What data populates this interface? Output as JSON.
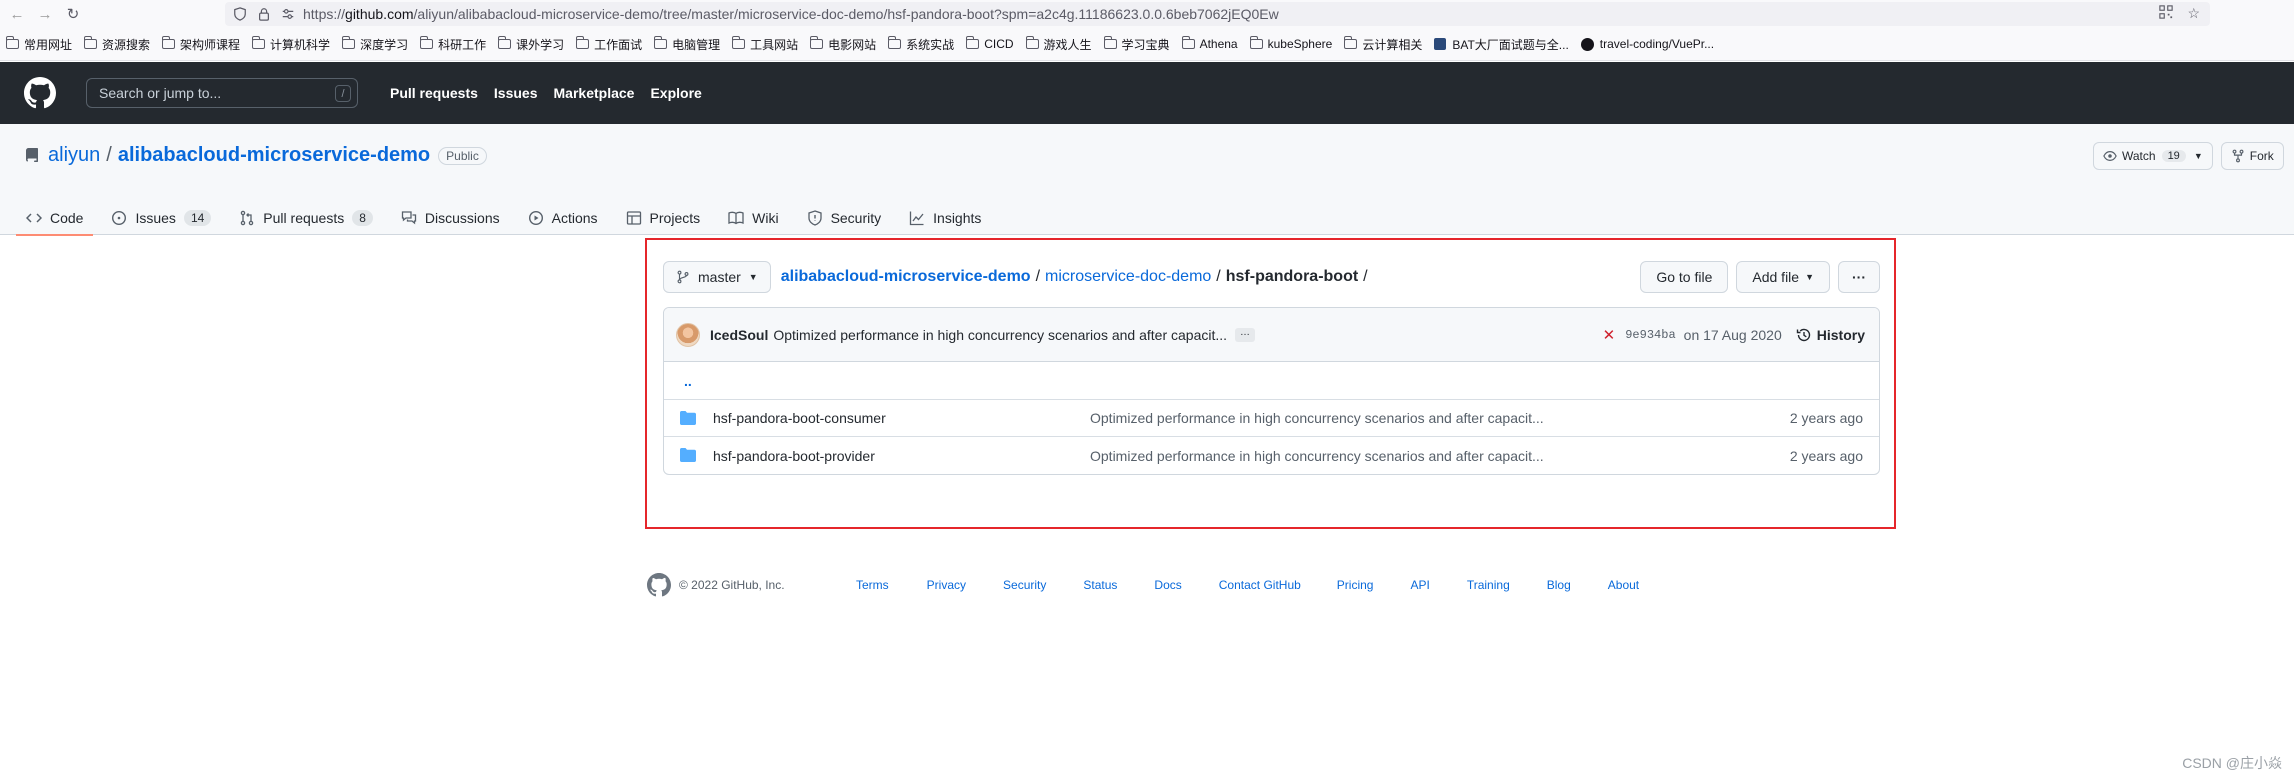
{
  "browser": {
    "url_prefix": "https://",
    "url_domain": "github.com",
    "url_path": "/aliyun/alibabacloud-microservice-demo/tree/master/microservice-doc-demo/hsf-pandora-boot?spm=a2c4g.11186623.0.0.6beb7062jEQ0Ew",
    "bookmarks": [
      "常用网址",
      "资源搜索",
      "架构师课程",
      "计算机科学",
      "深度学习",
      "科研工作",
      "课外学习",
      "工作面试",
      "电脑管理",
      "工具网站",
      "电影网站",
      "系统实战",
      "CICD",
      "游戏人生",
      "学习宝典",
      "Athena",
      "kubeSphere",
      "云计算相关"
    ],
    "bookmark_bat": "BAT大厂面试题与全...",
    "bookmark_travel": "travel-coding/VuePr..."
  },
  "header": {
    "search_placeholder": "Search or jump to...",
    "search_shortcut": "/",
    "nav": [
      "Pull requests",
      "Issues",
      "Marketplace",
      "Explore"
    ]
  },
  "repo": {
    "owner": "aliyun",
    "separator": "/",
    "name": "alibabacloud-microservice-demo",
    "visibility": "Public",
    "watch_label": "Watch",
    "watch_count": "19",
    "fork_label": "Fork",
    "tabs": [
      {
        "label": "Code",
        "count": ""
      },
      {
        "label": "Issues",
        "count": "14"
      },
      {
        "label": "Pull requests",
        "count": "8"
      },
      {
        "label": "Discussions",
        "count": ""
      },
      {
        "label": "Actions",
        "count": ""
      },
      {
        "label": "Projects",
        "count": ""
      },
      {
        "label": "Wiki",
        "count": ""
      },
      {
        "label": "Security",
        "count": ""
      },
      {
        "label": "Insights",
        "count": ""
      }
    ]
  },
  "file_nav": {
    "branch": "master",
    "crumb_repo": "alibabacloud-microservice-demo",
    "crumb_dir": "microservice-doc-demo",
    "crumb_current": "hsf-pandora-boot",
    "slash": "/",
    "go_to_file": "Go to file",
    "add_file": "Add file",
    "more": "···"
  },
  "commit": {
    "author": "IcedSoul",
    "message": "Optimized performance in high concurrency scenarios and after capacit...",
    "ellipsis": "…",
    "sha": "9e934ba",
    "date": "on 17 Aug 2020",
    "history": "History"
  },
  "files": {
    "parent": "..",
    "items": [
      {
        "name": "hsf-pandora-boot-consumer",
        "message": "Optimized performance in high concurrency scenarios and after capacit...",
        "age": "2 years ago"
      },
      {
        "name": "hsf-pandora-boot-provider",
        "message": "Optimized performance in high concurrency scenarios and after capacit...",
        "age": "2 years ago"
      }
    ]
  },
  "footer": {
    "copyright": "© 2022 GitHub, Inc.",
    "links": [
      "Terms",
      "Privacy",
      "Security",
      "Status",
      "Docs",
      "Contact GitHub",
      "Pricing",
      "API",
      "Training",
      "Blog",
      "About"
    ]
  },
  "watermark": "CSDN @庄小焱",
  "colors": {
    "header_bg": "#24292f",
    "link": "#0969da",
    "active_tab_underline": "#fd8c73",
    "highlight_frame": "#e5262b",
    "folder_icon": "#54aeff"
  }
}
